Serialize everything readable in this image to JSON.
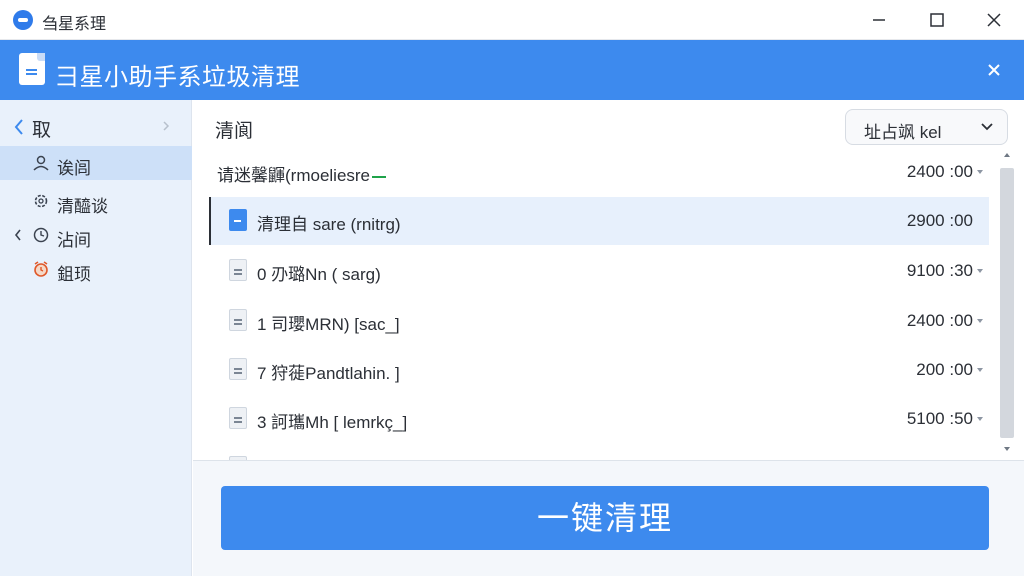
{
  "window": {
    "title": "刍星系理"
  },
  "header": {
    "title": "彐星小助手系垃圾清理"
  },
  "sidebar": {
    "back_label": "取",
    "items": [
      {
        "label": "诶闾",
        "icon": "user-icon",
        "active": true
      },
      {
        "label": "清醯谈",
        "icon": "gear-icon",
        "active": false
      },
      {
        "label": "沾间",
        "icon": "clock-icon",
        "active": false
      },
      {
        "label": "鉏顼",
        "icon": "alarm-clock-icon",
        "active": false
      }
    ]
  },
  "main": {
    "section_title": "清阆",
    "sort_dropdown": {
      "selected": "址占飒  kel"
    },
    "files": [
      {
        "name": "请迷馨鼲(rmoeliesre",
        "size": "2400 :00",
        "icon": "none",
        "selected": false
      },
      {
        "name": "清理自 sare (rnitrg)",
        "size": "2900 :00",
        "icon": "blue-file-icon",
        "selected": true
      },
      {
        "name": "0 刅璐Nn ( sarg)",
        "size": "9100 :30",
        "icon": "file-icon",
        "selected": false
      },
      {
        "name": "1 司瓔MRN) [sac_]",
        "size": "2400 :00",
        "icon": "file-icon",
        "selected": false
      },
      {
        "name": "7 狩蓰Pandtlahin. ]",
        "size": "200 :00",
        "icon": "file-icon",
        "selected": false
      },
      {
        "name": "3 訶瓗Mh [ lemrkç_]",
        "size": "5100 :50",
        "icon": "file-icon",
        "selected": false
      }
    ],
    "clean_button_label": "一键清理"
  }
}
